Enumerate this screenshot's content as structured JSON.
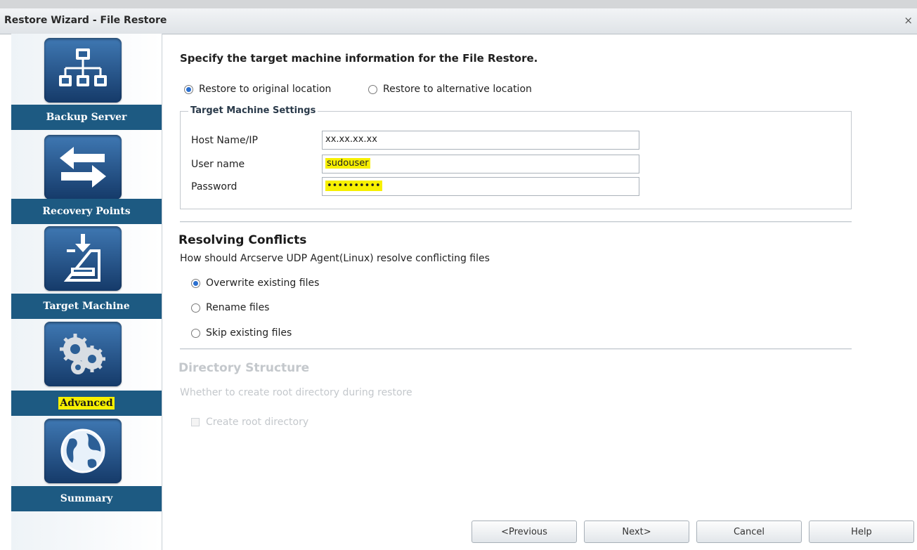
{
  "window": {
    "title": "Restore Wizard - File Restore",
    "close_glyph": "×"
  },
  "sidebar": {
    "steps": [
      {
        "label": "Backup Server",
        "icon": "network-tree-icon"
      },
      {
        "label": "Recovery Points",
        "icon": "swap-arrows-icon"
      },
      {
        "label": "Target Machine",
        "icon": "download-drive-icon"
      },
      {
        "label": "Advanced",
        "icon": "gears-icon",
        "active": true
      },
      {
        "label": "Summary",
        "icon": "globe-icon"
      }
    ]
  },
  "main": {
    "heading": "Specify the target machine information for the File Restore.",
    "location_options": [
      {
        "label": "Restore to original location",
        "selected": true
      },
      {
        "label": "Restore to alternative location",
        "selected": false
      }
    ],
    "target_settings": {
      "legend": "Target Machine Settings",
      "host": {
        "label": "Host Name/IP",
        "value": "xx.xx.xx.xx"
      },
      "user": {
        "label": "User name",
        "value": "sudouser"
      },
      "password": {
        "label": "Password",
        "value": "••••••••••"
      }
    },
    "conflicts": {
      "title": "Resolving Conflicts",
      "description": "How should Arcserve UDP Agent(Linux) resolve conflicting files",
      "options": [
        {
          "label": "Overwrite existing files",
          "selected": true
        },
        {
          "label": "Rename files",
          "selected": false
        },
        {
          "label": "Skip existing files",
          "selected": false
        }
      ]
    },
    "directory": {
      "title": "Directory Structure",
      "description": "Whether to create root directory during restore",
      "checkbox_label": "Create root directory"
    }
  },
  "footer": {
    "previous": "<Previous",
    "next": "Next>",
    "cancel": "Cancel",
    "help": "Help"
  },
  "colors": {
    "accent": "#1d5a82",
    "highlight": "#f7f000",
    "radio": "#2a6fcf"
  }
}
